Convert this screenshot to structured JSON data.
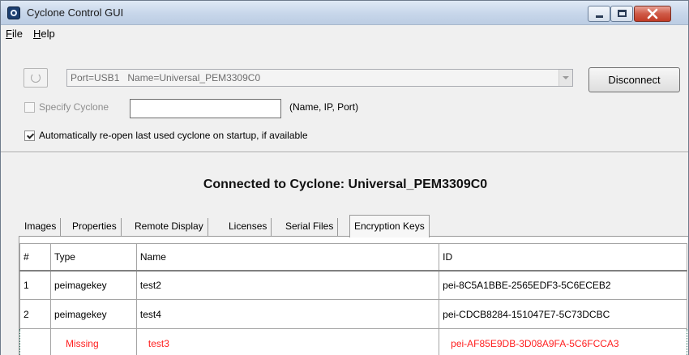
{
  "window": {
    "title": "Cyclone Control GUI"
  },
  "menu": [
    {
      "accel": "F",
      "rest": "ile"
    },
    {
      "accel": "H",
      "rest": "elp"
    }
  ],
  "connection": {
    "port_combo_value": "Port=USB1   Name=Universal_PEM3309C0",
    "disconnect_label": "Disconnect",
    "specify_label": "Specify Cyclone",
    "specify_checked": false,
    "specify_input_value": "",
    "specify_hint": "(Name, IP, Port)",
    "autoopen_label": "Automatically re-open last used cyclone on startup, if available",
    "autoopen_checked": true
  },
  "status": {
    "text": "Connected to Cyclone: Universal_PEM3309C0"
  },
  "tabs": [
    "Images",
    "Properties",
    "Remote Display",
    "Licenses",
    "Serial Files",
    "Encryption Keys"
  ],
  "active_tab": "Encryption Keys",
  "table": {
    "columns": [
      "#",
      "Type",
      "Name",
      "ID"
    ],
    "rows": [
      {
        "num": "1",
        "type": "peimagekey",
        "name": "test2",
        "id": "pei-8C5A1BBE-2565EDF3-5C6ECEB2"
      },
      {
        "num": "2",
        "type": "peimagekey",
        "name": "test4",
        "id": "pei-CDCB8284-151047E7-5C73DCBC"
      },
      {
        "num": "",
        "type": "Missing",
        "name": "test3",
        "id": "pei-AF85E9DB-3D08A9FA-5C6FCCA3",
        "missing": true
      }
    ]
  },
  "colors": {
    "missing_row_text": "#ff1f1f",
    "close_button": "#c13b26",
    "titlebar": "#c7d6ea"
  }
}
